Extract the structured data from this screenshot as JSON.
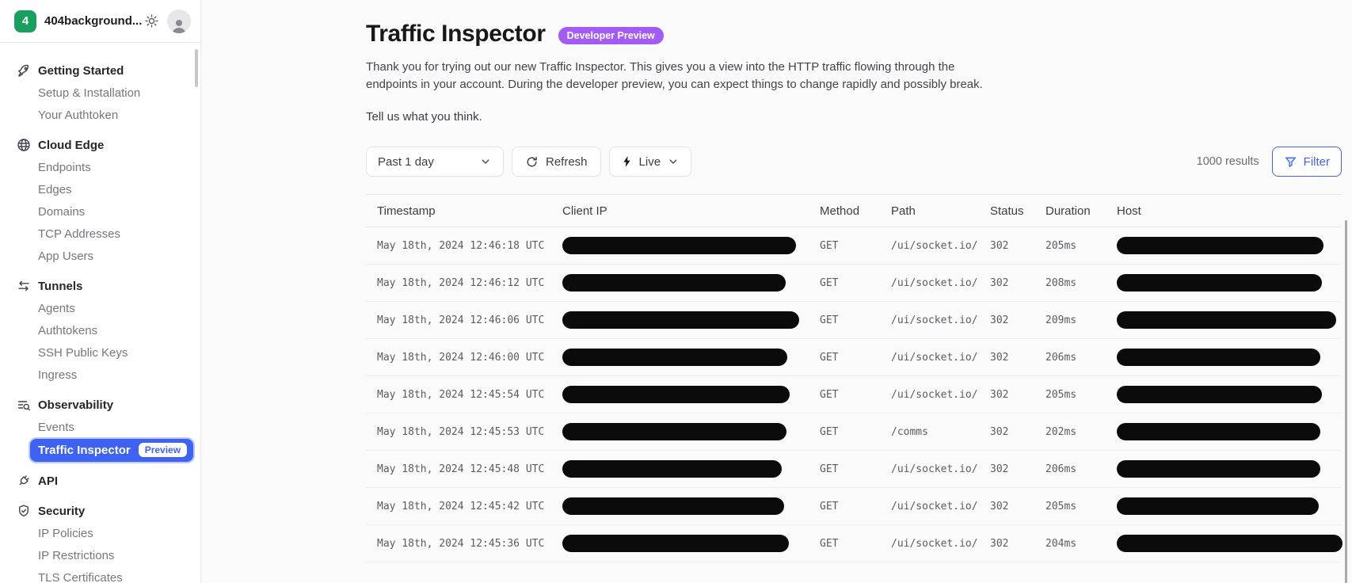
{
  "colors": {
    "accent_blue": "#3e63f3",
    "badge_purple": "#a35bf5",
    "brand_green": "#18a05e"
  },
  "topbar": {
    "logo_badge": "4",
    "account_name": "404background..."
  },
  "sidebar": {
    "sections": [
      {
        "label": "Getting Started",
        "icon": "rocket-icon",
        "items": [
          {
            "label": "Setup & Installation"
          },
          {
            "label": "Your Authtoken"
          }
        ]
      },
      {
        "label": "Cloud Edge",
        "icon": "globe-icon",
        "items": [
          {
            "label": "Endpoints"
          },
          {
            "label": "Edges"
          },
          {
            "label": "Domains"
          },
          {
            "label": "TCP Addresses"
          },
          {
            "label": "App Users"
          }
        ]
      },
      {
        "label": "Tunnels",
        "icon": "swap-arrows-icon",
        "items": [
          {
            "label": "Agents"
          },
          {
            "label": "Authtokens"
          },
          {
            "label": "SSH Public Keys"
          },
          {
            "label": "Ingress"
          }
        ]
      },
      {
        "label": "Observability",
        "icon": "list-search-icon",
        "items": [
          {
            "label": "Events"
          },
          {
            "label": "Traffic Inspector",
            "badge": "Preview",
            "active": true
          }
        ]
      },
      {
        "label": "API",
        "icon": "plug-icon",
        "items": []
      },
      {
        "label": "Security",
        "icon": "shield-check-icon",
        "items": [
          {
            "label": "IP Policies"
          },
          {
            "label": "IP Restrictions"
          },
          {
            "label": "TLS Certificates"
          }
        ]
      }
    ]
  },
  "main": {
    "title": "Traffic Inspector",
    "preview_badge": "Developer Preview",
    "description": "Thank you for trying out our new Traffic Inspector. This gives you a view into the HTTP traffic flowing through the endpoints in your account. During the developer preview, you can expect things to change rapidly and possibly break.",
    "feedback_link": "Tell us what you think.",
    "controls": {
      "time_range": "Past 1 day",
      "refresh_label": "Refresh",
      "live_label": "Live",
      "results_text": "1000 results",
      "filter_label": "Filter"
    },
    "table": {
      "columns": [
        "Timestamp",
        "Client IP",
        "Method",
        "Path",
        "Status",
        "Duration",
        "Host"
      ],
      "rows": [
        {
          "timestamp": "May 18th, 2024 12:46:18 UTC",
          "method": "GET",
          "path": "/ui/socket.io/",
          "status": "302",
          "duration": "205ms",
          "ip_w": 295,
          "host_w": 261
        },
        {
          "timestamp": "May 18th, 2024 12:46:12 UTC",
          "method": "GET",
          "path": "/ui/socket.io/",
          "status": "302",
          "duration": "208ms",
          "ip_w": 282,
          "host_w": 259
        },
        {
          "timestamp": "May 18th, 2024 12:46:06 UTC",
          "method": "GET",
          "path": "/ui/socket.io/",
          "status": "302",
          "duration": "209ms",
          "ip_w": 299,
          "host_w": 277
        },
        {
          "timestamp": "May 18th, 2024 12:46:00 UTC",
          "method": "GET",
          "path": "/ui/socket.io/",
          "status": "302",
          "duration": "206ms",
          "ip_w": 284,
          "host_w": 257
        },
        {
          "timestamp": "May 18th, 2024 12:45:54 UTC",
          "method": "GET",
          "path": "/ui/socket.io/",
          "status": "302",
          "duration": "205ms",
          "ip_w": 287,
          "host_w": 259
        },
        {
          "timestamp": "May 18th, 2024 12:45:53 UTC",
          "method": "GET",
          "path": "/comms",
          "status": "302",
          "duration": "202ms",
          "ip_w": 283,
          "host_w": 257
        },
        {
          "timestamp": "May 18th, 2024 12:45:48 UTC",
          "method": "GET",
          "path": "/ui/socket.io/",
          "status": "302",
          "duration": "206ms",
          "ip_w": 277,
          "host_w": 257
        },
        {
          "timestamp": "May 18th, 2024 12:45:42 UTC",
          "method": "GET",
          "path": "/ui/socket.io/",
          "status": "302",
          "duration": "205ms",
          "ip_w": 280,
          "host_w": 255
        },
        {
          "timestamp": "May 18th, 2024 12:45:36 UTC",
          "method": "GET",
          "path": "/ui/socket.io/",
          "status": "302",
          "duration": "204ms",
          "ip_w": 286,
          "host_w": 285
        }
      ]
    }
  }
}
